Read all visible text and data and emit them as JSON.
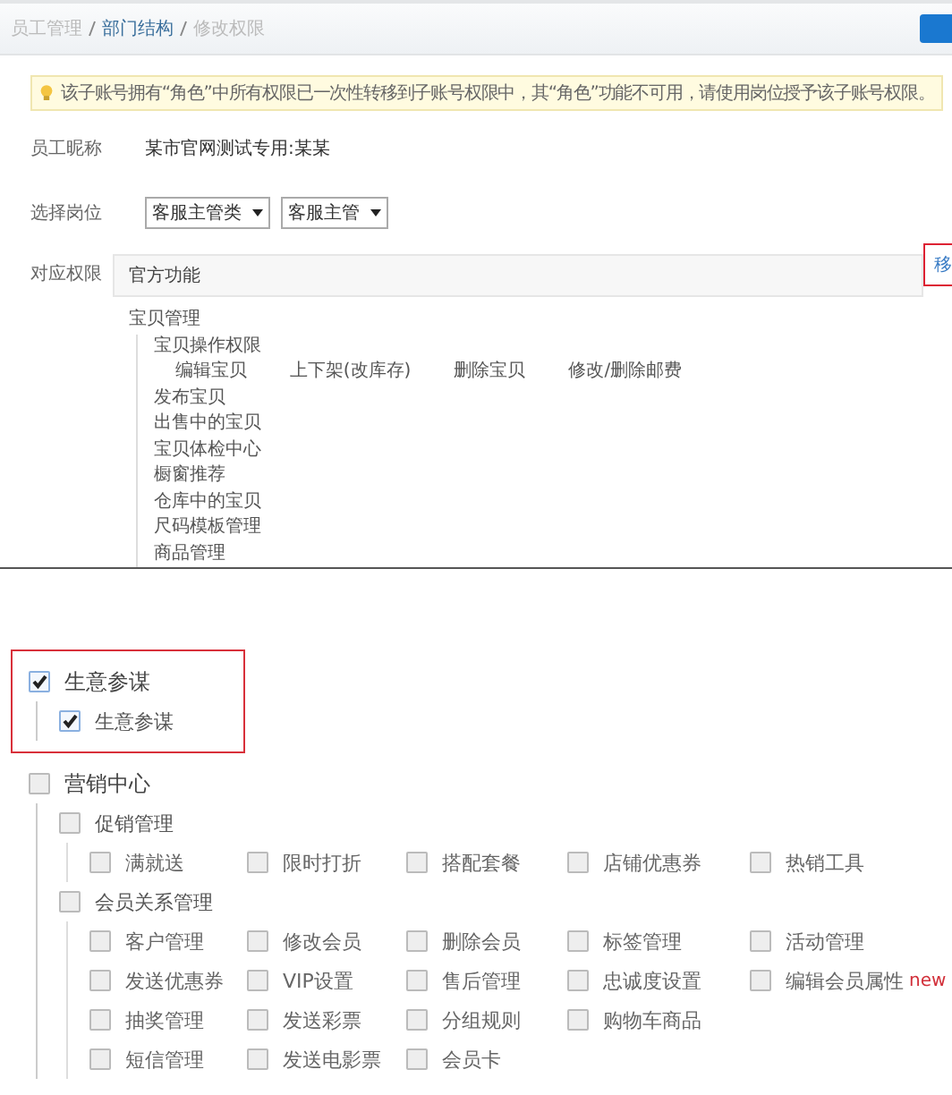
{
  "breadcrumb": [
    {
      "label": "员工管理",
      "link": false
    },
    {
      "label": "部门结构",
      "link": true
    },
    {
      "label": "修改权限",
      "link": false
    }
  ],
  "notice": "该子账号拥有“角色”中所有权限已一次性转移到子账号权限中，其“角色”功能不可用，请使用岗位授予该子账号权限。",
  "fields": [
    {
      "label": "员工昵称",
      "value": "某市官网测试专用:某某"
    }
  ],
  "position": {
    "label": "选择岗位",
    "selects": [
      "客服主管类",
      "客服主管"
    ]
  },
  "permissions": {
    "label": "对应权限",
    "header": "官方功能",
    "action": "移",
    "tree": [
      {
        "label": "宝贝管理",
        "children": [
          {
            "label": "宝贝操作权限",
            "children": [
              {
                "label": "编辑宝贝"
              },
              {
                "label": "上下架(改库存)"
              },
              {
                "label": "删除宝贝"
              },
              {
                "label": "修改/删除邮费"
              }
            ]
          },
          {
            "label": "发布宝贝"
          },
          {
            "label": "出售中的宝贝"
          },
          {
            "label": "宝贝体检中心"
          },
          {
            "label": "橱窗推荐"
          },
          {
            "label": "仓库中的宝贝"
          },
          {
            "label": "尺码模板管理"
          },
          {
            "label": "商品管理"
          }
        ]
      }
    ]
  },
  "groups": [
    {
      "label": "生意参谋",
      "checked": true,
      "highlighted": true,
      "children": [
        {
          "label": "生意参谋",
          "checked": true
        }
      ]
    },
    {
      "label": "营销中心",
      "checked": false,
      "highlighted": false,
      "children": [
        {
          "label": "促销管理",
          "checked": false,
          "option_rows": [
            [
              {
                "label": "满就送",
                "checked": false
              },
              {
                "label": "限时打折",
                "checked": false
              },
              {
                "label": "搭配套餐",
                "checked": false
              },
              {
                "label": "店铺优惠券",
                "checked": false
              },
              {
                "label": "热销工具",
                "checked": false
              }
            ]
          ]
        },
        {
          "label": "会员关系管理",
          "checked": false,
          "option_rows": [
            [
              {
                "label": "客户管理",
                "checked": false
              },
              {
                "label": "修改会员",
                "checked": false
              },
              {
                "label": "删除会员",
                "checked": false
              },
              {
                "label": "标签管理",
                "checked": false
              },
              {
                "label": "活动管理",
                "checked": false
              }
            ],
            [
              {
                "label": "发送优惠券",
                "checked": false
              },
              {
                "label": "VIP设置",
                "checked": false
              },
              {
                "label": "售后管理",
                "checked": false
              },
              {
                "label": "忠诚度设置",
                "checked": false
              },
              {
                "label": "编辑会员属性",
                "checked": false,
                "badge": "new"
              }
            ],
            [
              {
                "label": "抽奖管理",
                "checked": false
              },
              {
                "label": "发送彩票",
                "checked": false
              },
              {
                "label": "分组规则",
                "checked": false
              },
              {
                "label": "购物车商品",
                "checked": false
              }
            ],
            [
              {
                "label": "短信管理",
                "checked": false
              },
              {
                "label": "发送电影票",
                "checked": false
              },
              {
                "label": "会员卡",
                "checked": false
              }
            ]
          ]
        }
      ]
    }
  ]
}
